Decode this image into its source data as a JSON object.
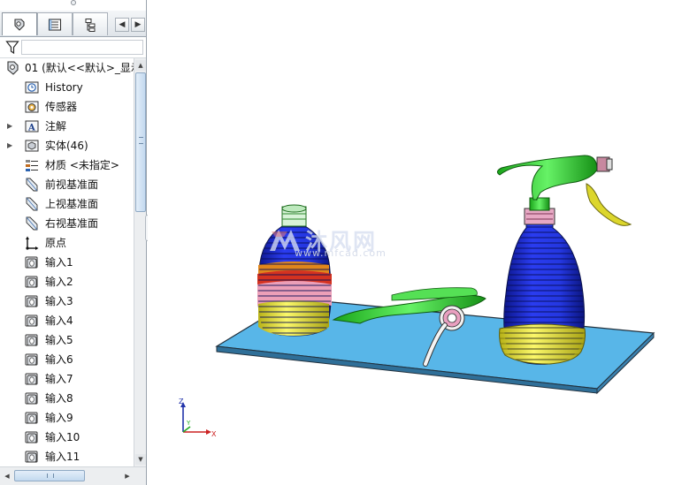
{
  "panel": {
    "tabs": [
      {
        "name": "featuremanager-tab",
        "icon": "feature-tree-icon"
      },
      {
        "name": "propertymanager-tab",
        "icon": "property-manager-icon"
      },
      {
        "name": "configurationmanager-tab",
        "icon": "configuration-manager-icon"
      }
    ],
    "nav_left": "◀",
    "nav_right": "▶",
    "filter_icon": "filter-icon",
    "tree": {
      "root_label": "01  (默认<<默认>_显示",
      "items": [
        {
          "label": "History",
          "icon": "history-icon",
          "expandable": false
        },
        {
          "label": "传感器",
          "icon": "sensor-icon",
          "expandable": false
        },
        {
          "label": "注解",
          "icon": "annotation-icon",
          "expandable": true
        },
        {
          "label": "实体(46)",
          "icon": "solid-bodies-icon",
          "expandable": true
        },
        {
          "label": "材质 <未指定>",
          "icon": "material-icon",
          "expandable": false
        },
        {
          "label": "前视基准面",
          "icon": "plane-icon",
          "expandable": false
        },
        {
          "label": "上视基准面",
          "icon": "plane-icon",
          "expandable": false
        },
        {
          "label": "右视基准面",
          "icon": "plane-icon",
          "expandable": false
        },
        {
          "label": "原点",
          "icon": "origin-icon",
          "expandable": false
        },
        {
          "label": "输入1",
          "icon": "imported-body-icon",
          "expandable": false
        },
        {
          "label": "输入2",
          "icon": "imported-body-icon",
          "expandable": false
        },
        {
          "label": "输入3",
          "icon": "imported-body-icon",
          "expandable": false
        },
        {
          "label": "输入4",
          "icon": "imported-body-icon",
          "expandable": false
        },
        {
          "label": "输入5",
          "icon": "imported-body-icon",
          "expandable": false
        },
        {
          "label": "输入6",
          "icon": "imported-body-icon",
          "expandable": false
        },
        {
          "label": "输入7",
          "icon": "imported-body-icon",
          "expandable": false
        },
        {
          "label": "输入8",
          "icon": "imported-body-icon",
          "expandable": false
        },
        {
          "label": "输入9",
          "icon": "imported-body-icon",
          "expandable": false
        },
        {
          "label": "输入10",
          "icon": "imported-body-icon",
          "expandable": false
        },
        {
          "label": "输入11",
          "icon": "imported-body-icon",
          "expandable": false
        }
      ]
    },
    "scroll_up": "▲",
    "scroll_down": "▼",
    "scroll_left": "◀",
    "scroll_right": "▶"
  },
  "viewport": {
    "watermark_title": "沐风网",
    "watermark_url": "www.mfcad.com",
    "triad": {
      "x_label": "X",
      "y_label": "Y",
      "z_label": "Z"
    },
    "colors": {
      "base_plate": "#5bb8e8",
      "bottle_body": "#1e2fd6",
      "bottle_bottom": "#f2f04a",
      "trigger_green": "#3fdc3f",
      "trigger_lever": "#d9d42a",
      "ring_pink": "#e9a0b8",
      "ring_red": "#d8301e",
      "ring_orange": "#f08a1e"
    }
  }
}
